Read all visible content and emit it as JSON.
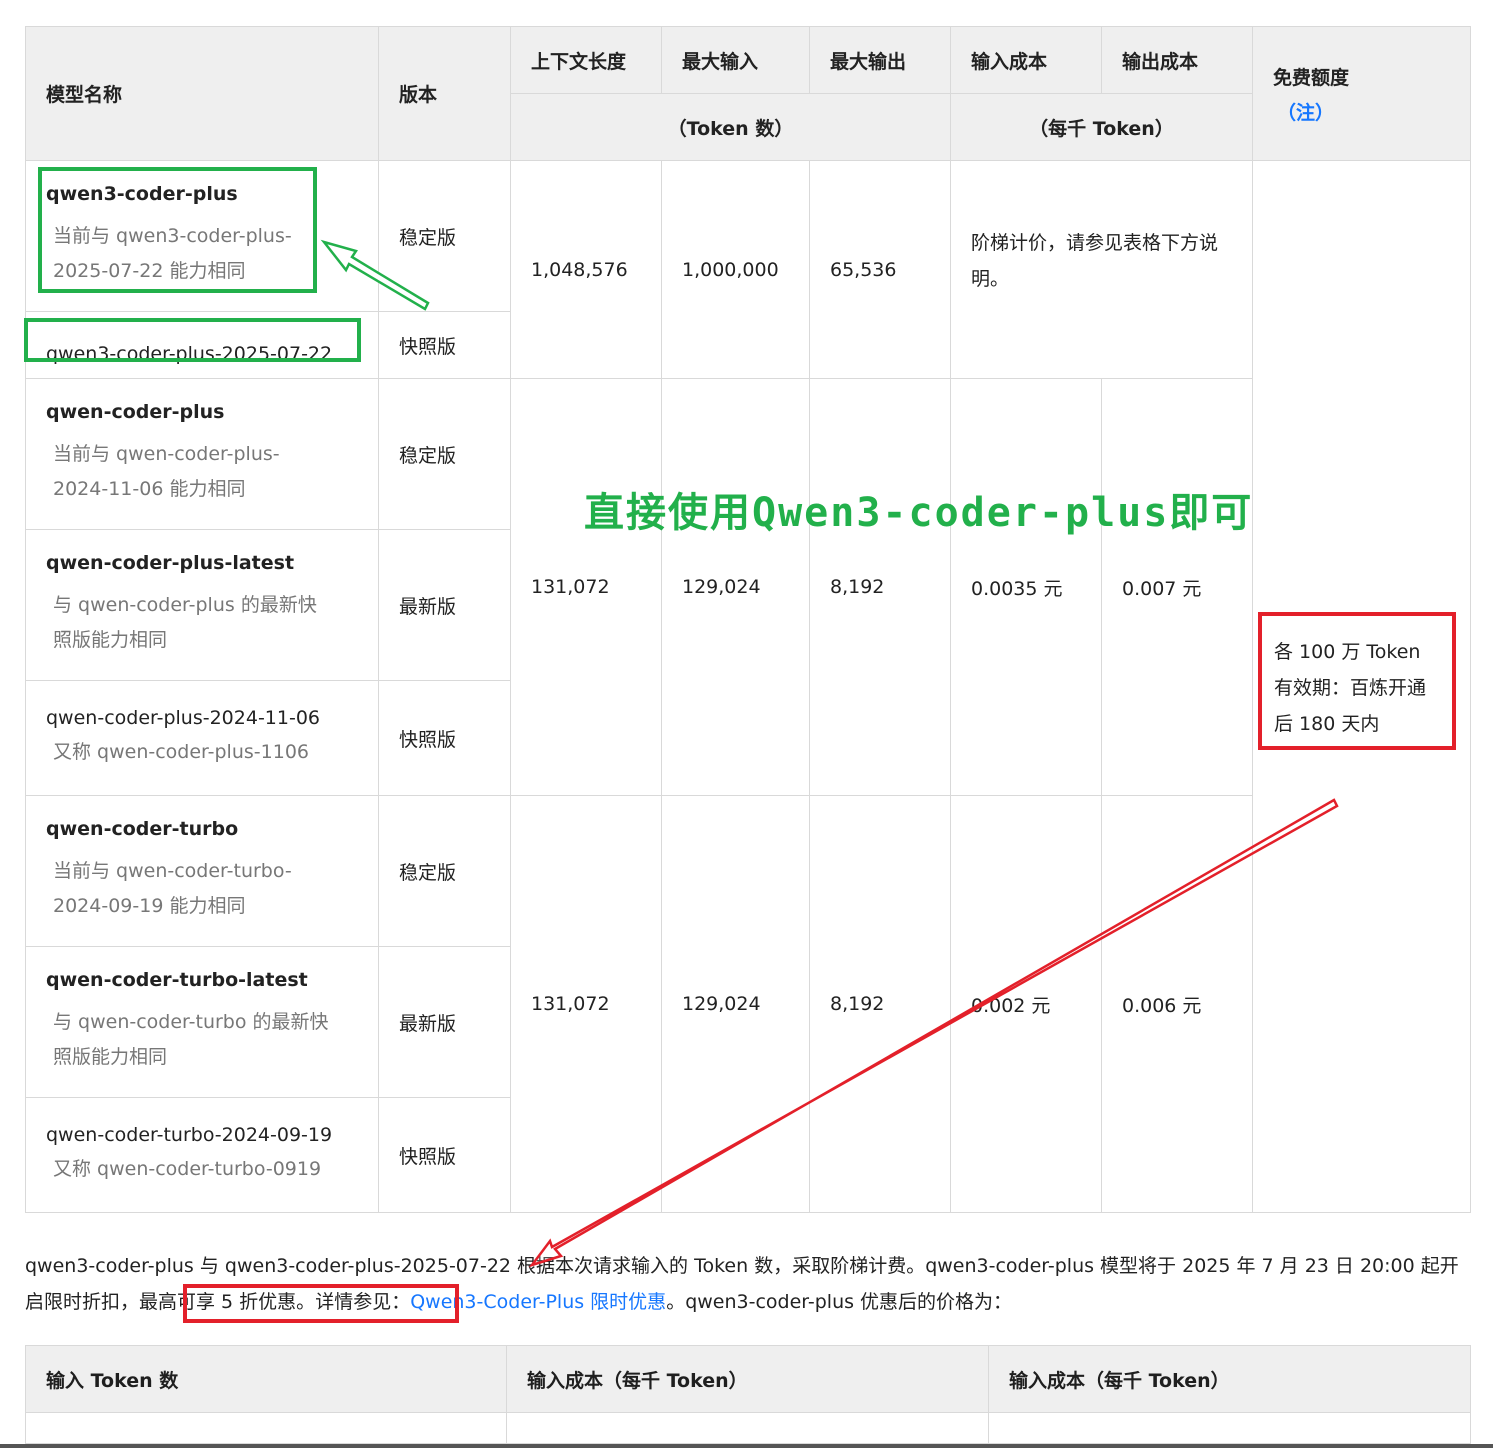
{
  "table1": {
    "headers": {
      "model_name": "模型名称",
      "version": "版本",
      "context_length": "上下文长度",
      "max_input": "最大输入",
      "max_output": "最大输出",
      "token_count_unit": "（Token 数）",
      "input_cost": "输入成本",
      "output_cost": "输出成本",
      "per_thousand_unit": "（每千 Token）",
      "free_quota": "免费额度",
      "note_link": "（注）"
    },
    "groups": [
      {
        "context_length": "1,048,576",
        "max_input": "1,000,000",
        "max_output": "65,536",
        "cost_text": "阶梯计价，请参见表格下方说明。",
        "models": [
          {
            "name": "qwen3-coder-plus",
            "sub": "当前与 qwen3-coder-plus-2025-07-22 能力相同",
            "version": "稳定版"
          },
          {
            "name": "qwen3-coder-plus-2025-07-22",
            "sub": "",
            "version": "快照版"
          }
        ]
      },
      {
        "context_length": "131,072",
        "max_input": "129,024",
        "max_output": "8,192",
        "input_cost": "0.0035 元",
        "output_cost": "0.007 元",
        "models": [
          {
            "name": "qwen-coder-plus",
            "sub": "当前与 qwen-coder-plus-2024-11-06 能力相同",
            "version": "稳定版"
          },
          {
            "name": "qwen-coder-plus-latest",
            "sub": "与 qwen-coder-plus 的最新快照版能力相同",
            "version": "最新版"
          },
          {
            "name": "qwen-coder-plus-2024-11-06",
            "sub": "又称 qwen-coder-plus-1106",
            "version": "快照版"
          }
        ]
      },
      {
        "context_length": "131,072",
        "max_input": "129,024",
        "max_output": "8,192",
        "input_cost": "0.002 元",
        "output_cost": "0.006 元",
        "models": [
          {
            "name": "qwen-coder-turbo",
            "sub": "当前与 qwen-coder-turbo-2024-09-19 能力相同",
            "version": "稳定版"
          },
          {
            "name": "qwen-coder-turbo-latest",
            "sub": "与 qwen-coder-turbo 的最新快照版能力相同",
            "version": "最新版"
          },
          {
            "name": "qwen-coder-turbo-2024-09-19",
            "sub": "又称 qwen-coder-turbo-0919",
            "version": "快照版"
          }
        ]
      }
    ],
    "free_quota_lines": [
      "各 100 万 Token",
      "有效期：百炼开通",
      "后 180 天内"
    ]
  },
  "paragraph": {
    "part1": "qwen3-coder-plus 与 qwen3-coder-plus-2025-07-22 根据本次请求输入的 Token 数，采取阶梯计费。qwen3-coder-plus 模型将于 2025 年 7 月 23 日 20:00 起开启限时",
    "highlight": "折扣，最高可享 5 折优惠。",
    "part2": "详情参见：",
    "link": "Qwen3-Coder-Plus 限时优惠",
    "part3": "。qwen3-coder-plus 优惠后的价格为："
  },
  "table2": {
    "headers": [
      "输入 Token 数",
      "输入成本（每千 Token）",
      "输入成本（每千 Token）"
    ]
  },
  "annotations": {
    "green_text": "直接使用Qwen3-coder-plus即可",
    "green_color": "#22b04b",
    "red_color": "#e3202a"
  }
}
